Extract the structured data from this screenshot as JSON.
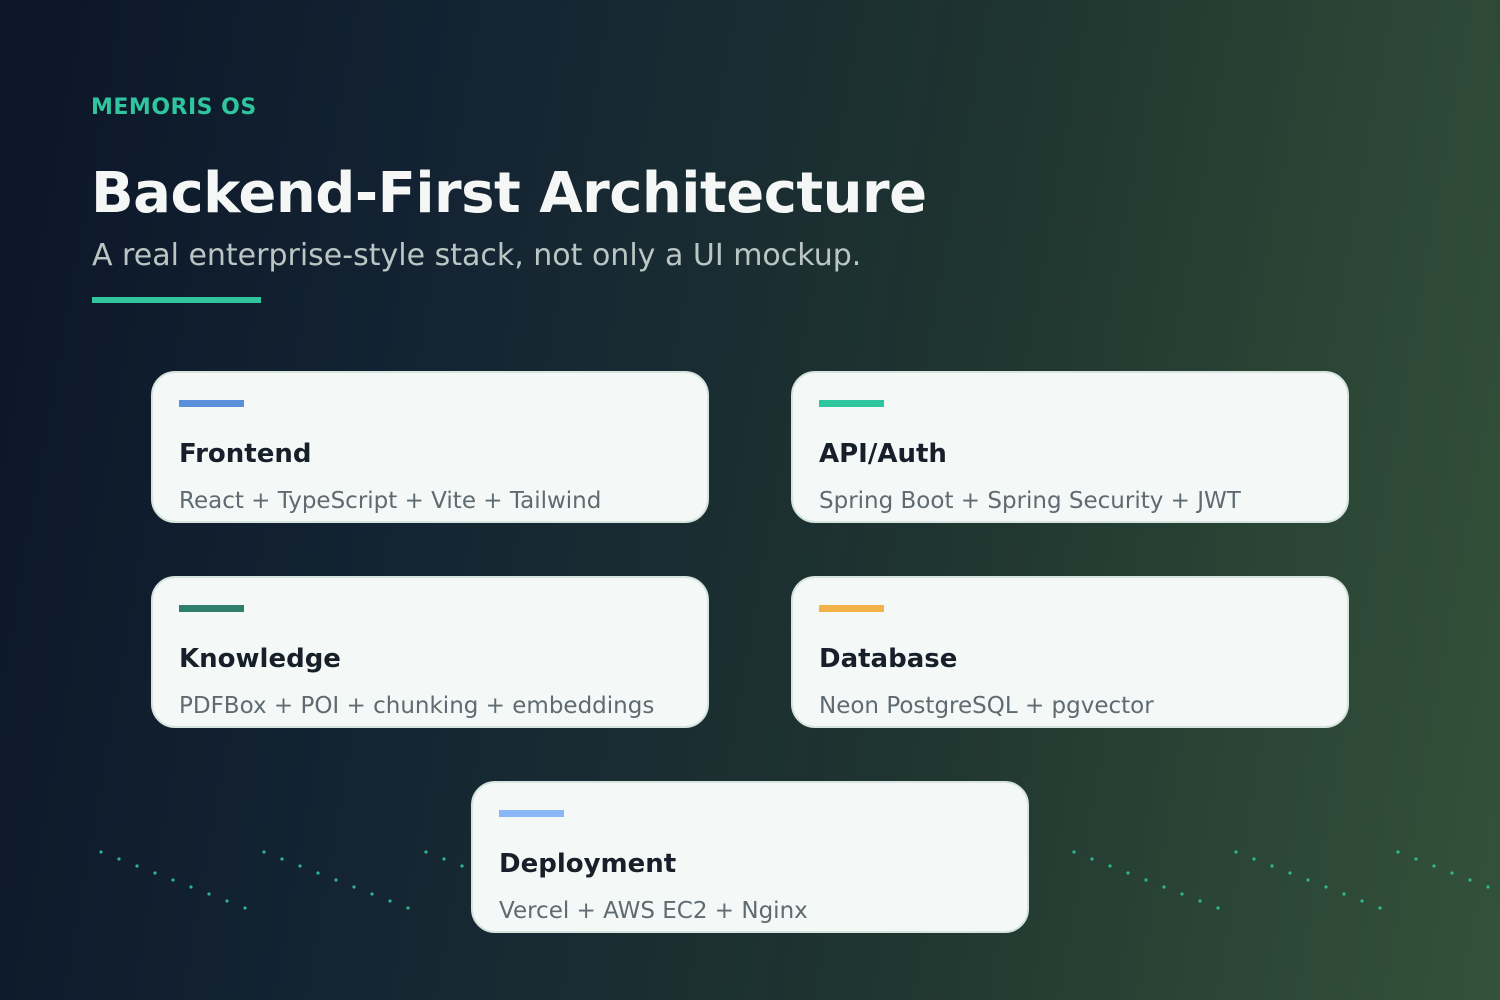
{
  "header": {
    "brand": "MEMORIS OS",
    "title": "Backend-First Architecture",
    "subtitle": "A real enterprise-style stack, not only a UI mockup."
  },
  "colors": {
    "brand": "#2fc59e",
    "rule": "#2fc59e",
    "dots": "#2fc59e",
    "card_background": "#f4f8f7",
    "card_border": "#d6e4df"
  },
  "cards": [
    {
      "title": "Frontend",
      "description": "React + TypeScript + Vite + Tailwind",
      "accent": "#5a8fdc"
    },
    {
      "title": "API/Auth",
      "description": "Spring Boot + Spring Security + JWT",
      "accent": "#2fc59e"
    },
    {
      "title": "Knowledge",
      "description": "PDFBox + POI + chunking + embeddings",
      "accent": "#2f7f6a"
    },
    {
      "title": "Database",
      "description": "Neon PostgreSQL + pgvector",
      "accent": "#f2b248"
    },
    {
      "title": "Deployment",
      "description": "Vercel + AWS EC2 + Nginx",
      "accent": "#8ab6f7"
    }
  ]
}
